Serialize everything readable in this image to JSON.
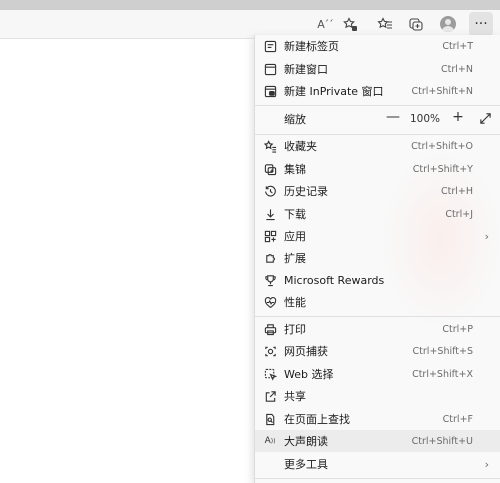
{
  "toolbar": {
    "read_aloud_glyph": "A´´",
    "more_glyph": "···"
  },
  "menu": {
    "new_tab": {
      "label": "新建标签页",
      "shortcut": "Ctrl+T"
    },
    "new_window": {
      "label": "新建窗口",
      "shortcut": "Ctrl+N"
    },
    "new_inprivate": {
      "label": "新建 InPrivate 窗口",
      "shortcut": "Ctrl+Shift+N"
    },
    "zoom": {
      "label": "缩放",
      "minus": "—",
      "value": "100%",
      "plus": "+"
    },
    "favorites": {
      "label": "收藏夹",
      "shortcut": "Ctrl+Shift+O"
    },
    "collections": {
      "label": "集锦",
      "shortcut": "Ctrl+Shift+Y"
    },
    "history": {
      "label": "历史记录",
      "shortcut": "Ctrl+H"
    },
    "downloads": {
      "label": "下载",
      "shortcut": "Ctrl+J"
    },
    "apps": {
      "label": "应用",
      "chevron": "›"
    },
    "extensions": {
      "label": "扩展"
    },
    "rewards": {
      "label": "Microsoft Rewards"
    },
    "performance": {
      "label": "性能"
    },
    "print": {
      "label": "打印",
      "shortcut": "Ctrl+P"
    },
    "web_capture": {
      "label": "网页捕获",
      "shortcut": "Ctrl+Shift+S"
    },
    "web_select": {
      "label": "Web 选择",
      "shortcut": "Ctrl+Shift+X"
    },
    "share": {
      "label": "共享"
    },
    "find": {
      "label": "在页面上查找",
      "shortcut": "Ctrl+F"
    },
    "read_aloud": {
      "label": "大声朗读",
      "shortcut": "Ctrl+Shift+U"
    },
    "more_tools": {
      "label": "更多工具",
      "chevron": "›"
    }
  },
  "colors": {
    "menu_bg": "#f9f9f9",
    "hover_bg": "#ececec",
    "toolbar_bg": "#f7f7f7"
  }
}
